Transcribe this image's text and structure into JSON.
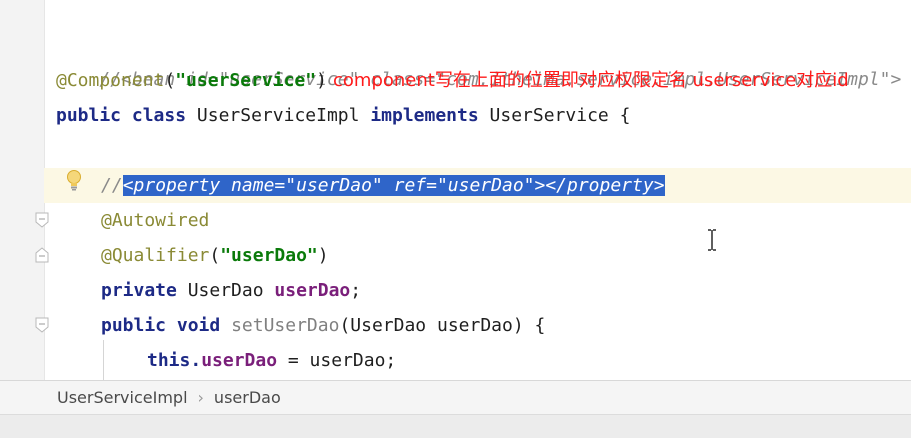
{
  "code": {
    "line1": "//<bean id=\"userService\" class=\"com.itheima.service.impl.UserServiceImpl\">",
    "line2_annotation": "@Component",
    "line2_open": "(",
    "line2_string": "\"userService\"",
    "line2_close": ")",
    "line3_kw1": "public",
    "line3_kw2": "class",
    "line3_name": "UserServiceImpl",
    "line3_kw3": "implements",
    "line3_iface": "UserService {",
    "line5_prefix": "//",
    "line5_selected": "<property name=\"userDao\" ref=\"userDao\"></property>",
    "line6_annotation": "@Autowired",
    "line7_annotation": "@Qualifier",
    "line7_open": "(",
    "line7_string": "\"userDao\"",
    "line7_close": ")",
    "line8_kw": "private",
    "line8_type": "UserDao",
    "line8_field": "userDao",
    "line8_end": ";",
    "line9_kw1": "public",
    "line9_kw2": "void",
    "line9_method": "setUserDao",
    "line9_params": "(UserDao userDao) {",
    "line10_kw": "this.",
    "line10_field": "userDao",
    "line10_rest": " = userDao;"
  },
  "note": "component写在上面的位置即对应权限定名 userservice对应id",
  "breadcrumb": {
    "class_name": "UserServiceImpl",
    "separator": "›",
    "member": "userDao"
  },
  "icons": [
    "fold-marker-icon",
    "lightbulb-icon",
    "text-cursor-icon"
  ],
  "colors": {
    "note": "#ff1a1a",
    "selection": "#2f65c9",
    "keyword": "#1d2a86",
    "string": "#0a7a0a",
    "field": "#7a1f7a"
  }
}
